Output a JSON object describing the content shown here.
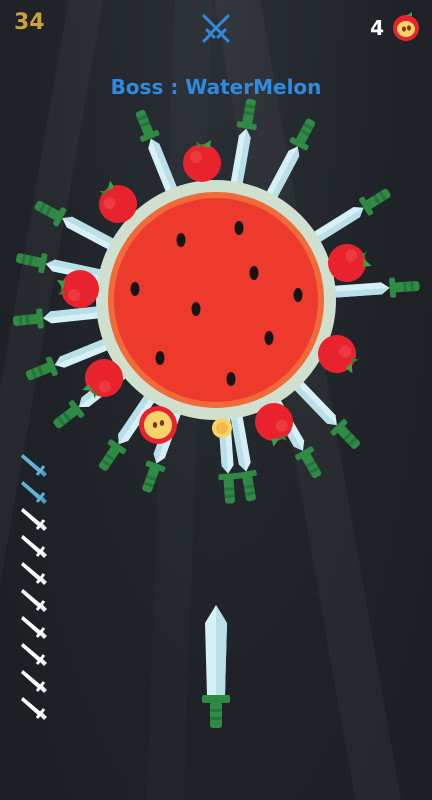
{
  "hud": {
    "score": "34",
    "apple_count": "4",
    "boss_title": "Boss : WaterMelon"
  },
  "target": {
    "name": "watermelon",
    "stuck_knives": 16,
    "apples_on_rim": 9,
    "sliced_apples": 1
  },
  "knife_queue": {
    "total": 10,
    "used": 2
  },
  "colors": {
    "score": "#c9a23a",
    "boss_title": "#2f8be0",
    "apple_count": "#ffffff",
    "background": "#1f2328",
    "melon_flesh": "#ee3a2c",
    "melon_rind": "#cfe0cf",
    "knife_blade": "#d6f1f6",
    "knife_handle": "#2f8a43",
    "apple": "#e8232d",
    "queue_used": "#5fb3d9",
    "queue_remaining": "#ffffff"
  },
  "icons": {
    "versus": "crossed-swords-icon",
    "apple": "apple-icon",
    "knife": "knife-icon"
  }
}
